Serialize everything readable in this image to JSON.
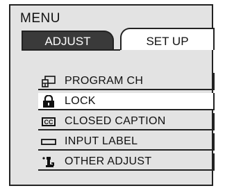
{
  "menu": {
    "title": "MENU",
    "tabs": [
      {
        "label": "ADJUST",
        "active": false
      },
      {
        "label": "SET UP",
        "active": true
      }
    ],
    "items": [
      {
        "label": "PROGRAM CH",
        "icon": "program-channel-icon"
      },
      {
        "label": "LOCK",
        "icon": "lock-icon",
        "selected": true
      },
      {
        "label": "CLOSED CAPTION",
        "icon": "closed-caption-icon"
      },
      {
        "label": "INPUT LABEL",
        "icon": "input-label-icon"
      },
      {
        "label": "OTHER ADJUST",
        "icon": "other-adjust-icon"
      }
    ]
  },
  "colors": {
    "panel_bg": "#e3e3e3",
    "inactive_tab_bg": "#3a3a3a",
    "active_tab_bg": "#ffffff",
    "selected_item_bg": "#ffffff",
    "border": "#222222"
  }
}
